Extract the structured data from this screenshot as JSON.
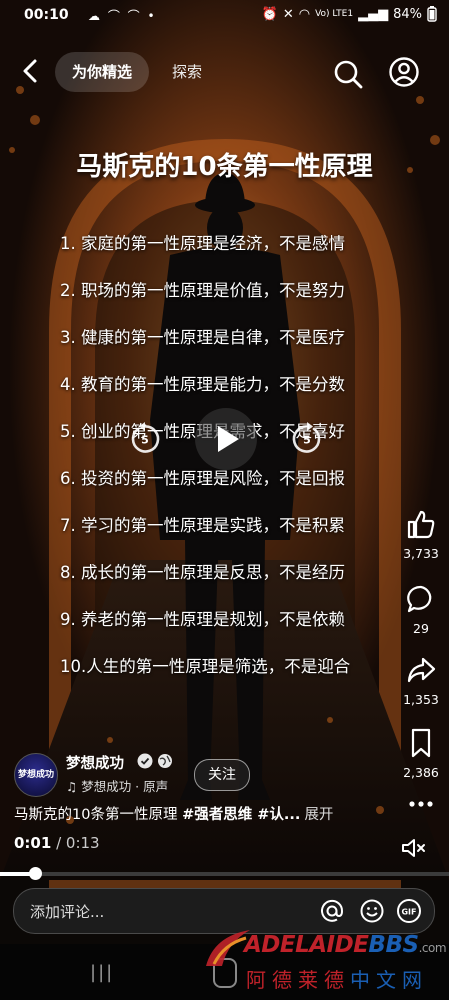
{
  "status_bar": {
    "time": "00:10",
    "network_label": "Vo) LTE1",
    "battery": "84%"
  },
  "top_nav": {
    "tab_active": "为你精选",
    "tab_explore": "探索"
  },
  "video": {
    "title": "马斯克的10条第一性原理",
    "principles": [
      "1. 家庭的第一性原理是经济，不是感情",
      "2. 职场的第一性原理是价值，不是努力",
      "3. 健康的第一性原理是自律，不是医疗",
      "4. 教育的第一性原理是能力，不是分数",
      "5. 创业的第一性原理是需求，不是喜好",
      "6. 投资的第一性原理是风险，不是回报",
      "7. 学习的第一性原理是实践，不是积累",
      "8. 成长的第一性原理是反思，不是经历",
      "9. 养老的第一性原理是规划，不是依赖",
      "10.人生的第一性原理是筛选，不是迎合"
    ],
    "skip_seconds": "5"
  },
  "actions": {
    "likes": "3,733",
    "comments": "29",
    "shares": "1,353",
    "saves": "2,386"
  },
  "author": {
    "avatar_text": "梦想成功",
    "name": "梦想成功",
    "sound": "梦想成功 · 原声",
    "follow_label": "关注"
  },
  "caption": {
    "text": "马斯克的10条第一性原理 ",
    "tags": "#强者思维 #认...",
    "more": "展开"
  },
  "playback": {
    "current": "0:01",
    "separator": " / ",
    "duration": "0:13",
    "progress_fraction": 0.077
  },
  "comment": {
    "placeholder": "添加评论..."
  },
  "watermark": {
    "brand_red": "ADELAIDE",
    "brand_blue": "BBS",
    "domain": ".com",
    "cn_red": "阿德莱德",
    "cn_blue": "中文网"
  },
  "colors": {
    "accent_red": "#c0222a",
    "accent_blue": "#1a5fb4",
    "tunnel_glow": "#b6501a"
  }
}
